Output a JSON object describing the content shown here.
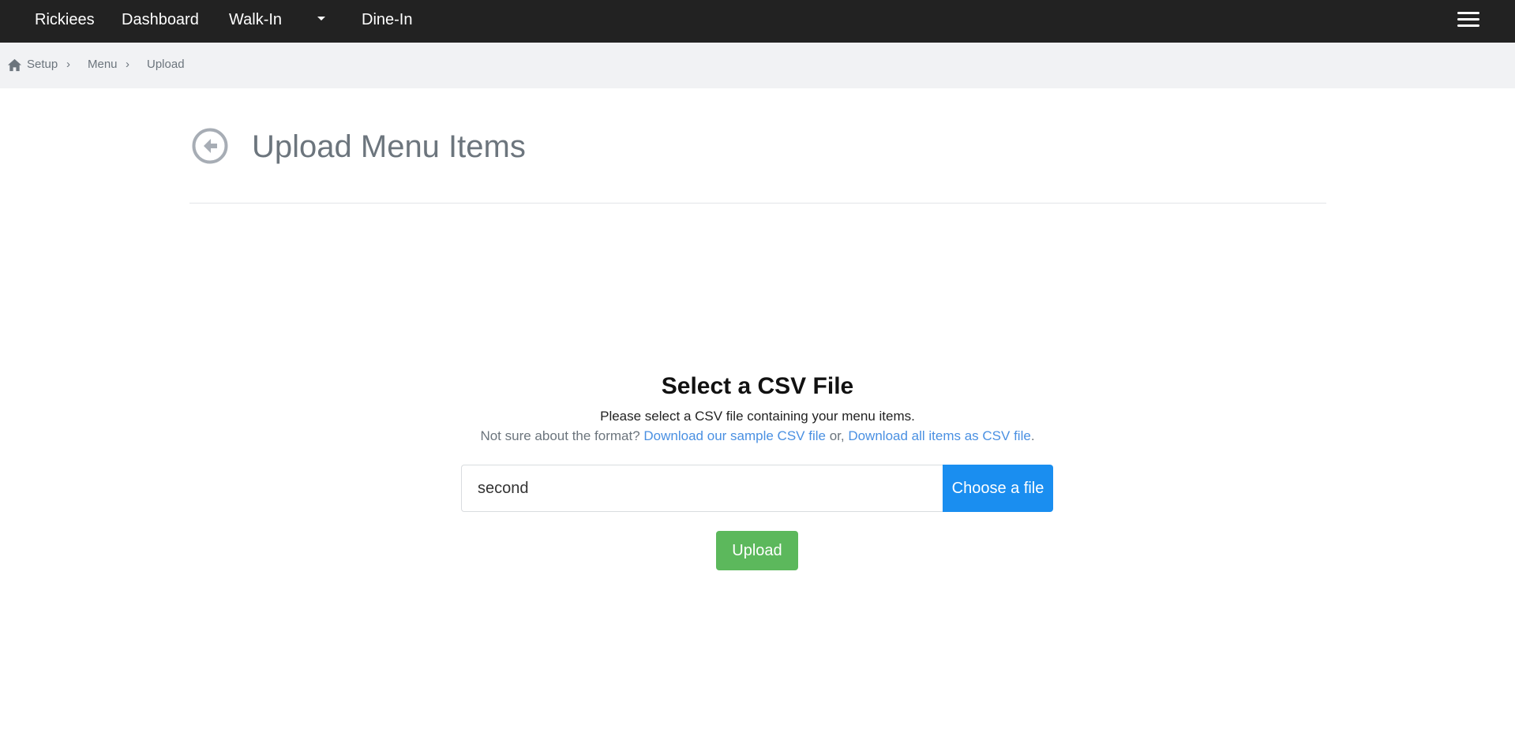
{
  "navbar": {
    "brand": "Rickiees",
    "items": [
      {
        "label": "Dashboard"
      },
      {
        "label": "Walk-In"
      },
      {
        "label": "Dine-In"
      }
    ],
    "icons": {
      "dropdown": "caret-down-icon",
      "menu": "hamburger-menu-icon"
    }
  },
  "breadcrumb": {
    "home_icon": "home-icon",
    "items": [
      "Setup",
      "Menu",
      "Upload"
    ],
    "separator": "›"
  },
  "header": {
    "back_icon": "arrow-left-circle-icon",
    "title": "Upload Menu Items"
  },
  "upload": {
    "title": "Select a CSV File",
    "description": "Please select a CSV file containing your menu items.",
    "hint_prefix": "Not sure about the format? ",
    "sample_link": "Download our sample CSV file",
    "hint_middle": " or, ",
    "all_items_link": "Download all items as CSV file",
    "hint_suffix": ".",
    "file_value": "second",
    "choose_label": "Choose a file",
    "upload_label": "Upload"
  },
  "colors": {
    "navbar_bg": "#222222",
    "breadcrumb_bg": "#f1f2f4",
    "link": "#4a90e2",
    "choose_button": "#1a8ef0",
    "upload_button": "#5cb85c"
  }
}
